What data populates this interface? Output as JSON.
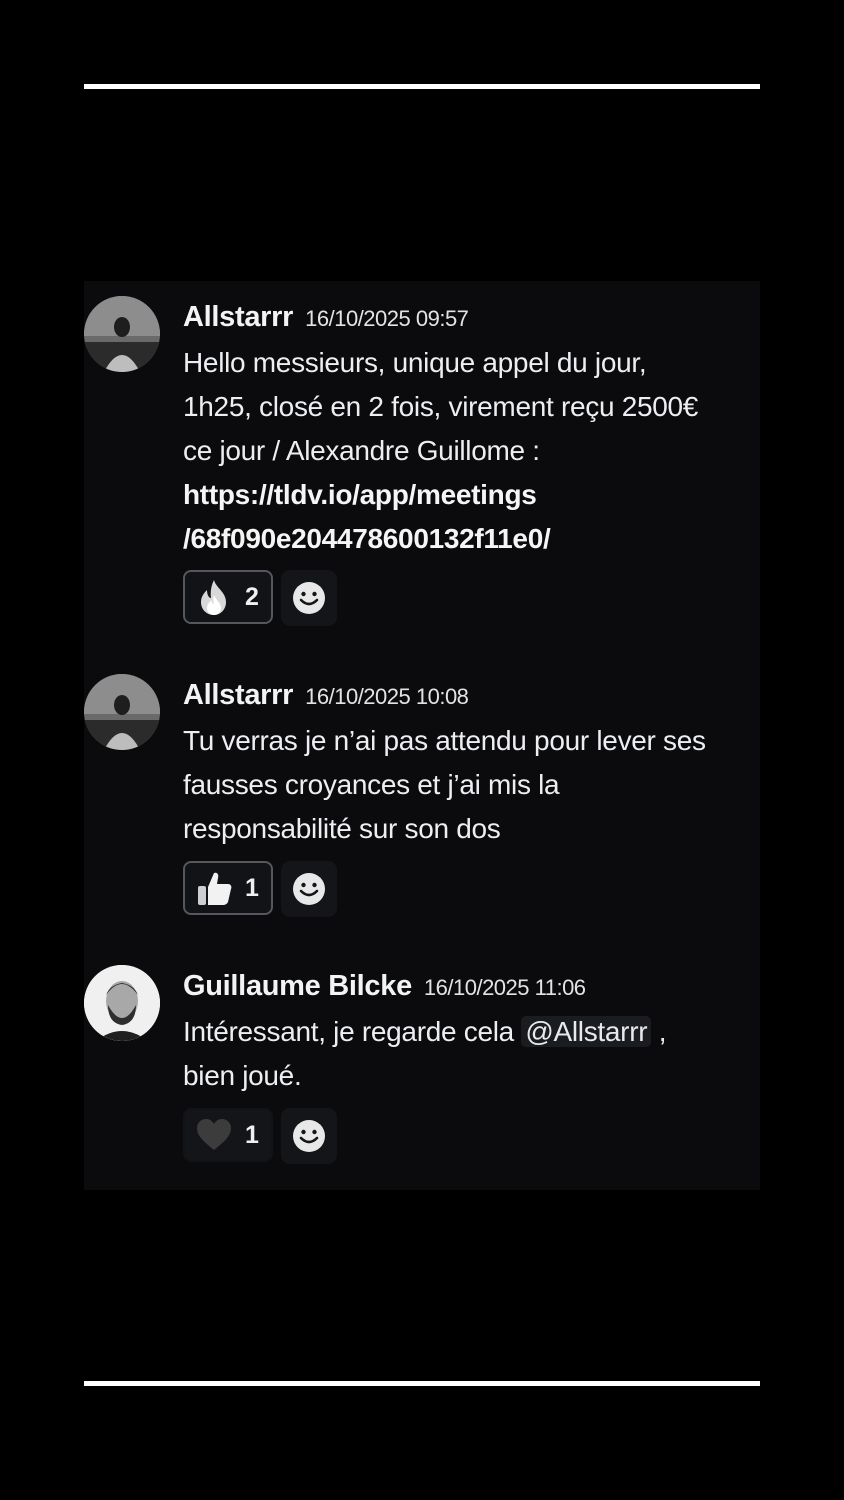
{
  "messages": [
    {
      "author": "Allstarrr",
      "timestamp": "16/10/2025 09:57",
      "text_lines": [
        "Hello messieurs, unique appel du jour,",
        "1h25, closé en 2 fois, virement reçu 2500€",
        "ce jour / Alexandre Guillome :"
      ],
      "link_lines": [
        "https://tldv.io/app/meetings",
        "/68f090e204478600132f11e0/"
      ],
      "reaction": {
        "icon": "fire-emoji-icon",
        "count": "2"
      }
    },
    {
      "author": "Allstarrr",
      "timestamp": "16/10/2025 10:08",
      "text_lines": [
        "Tu verras je n’ai pas attendu pour lever ses",
        "fausses croyances et j’ai mis la",
        "responsabilité sur son dos"
      ],
      "reaction": {
        "icon": "thumbs-up-emoji-icon",
        "count": "1"
      }
    },
    {
      "author": "Guillaume Bilcke",
      "timestamp": "16/10/2025 11:06",
      "text_before": "Intéressant, je regarde cela ",
      "mention": "@Allstarrr",
      "text_after": " ,",
      "text_line2": "bien joué.",
      "reaction": {
        "icon": "heart-emoji-icon",
        "count": "1"
      }
    }
  ],
  "colors": {
    "background": "#000000",
    "chat_background": "#0b0b0d",
    "text": "#eceef1",
    "reaction_border": "#55575c"
  }
}
